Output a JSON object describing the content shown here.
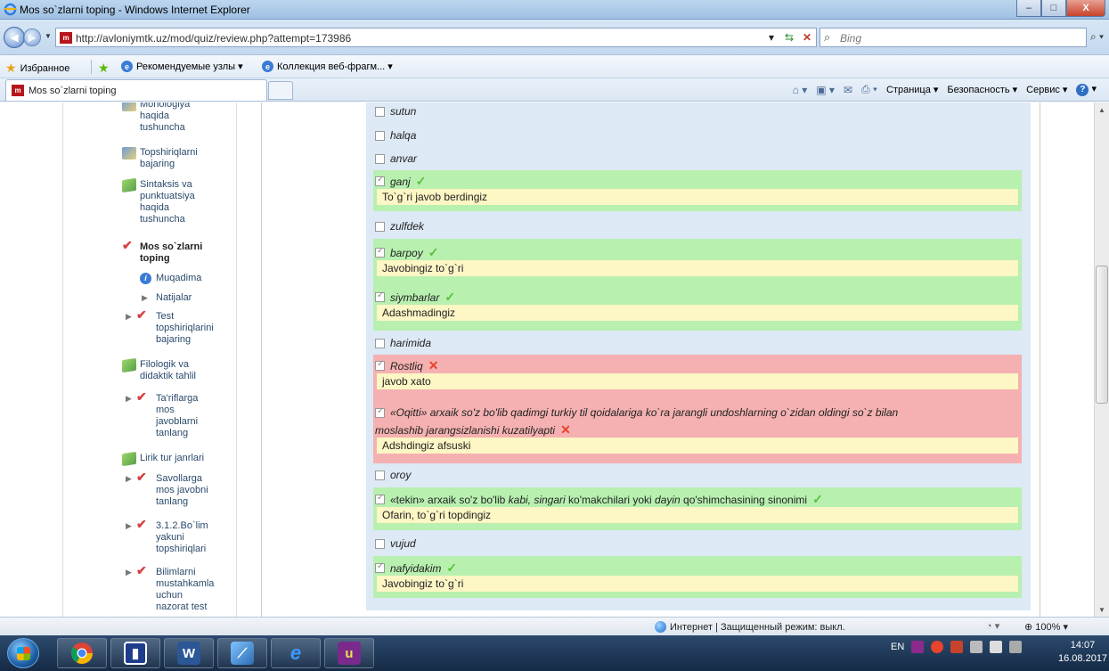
{
  "window": {
    "title": "Mos so`zlarni toping - Windows Internet Explorer",
    "minimize": "–",
    "maximize": "□",
    "close": "X"
  },
  "address": {
    "url": "http://avloniymtk.uz/mod/quiz/review.php?attempt=173986",
    "search_placeholder": "Bing"
  },
  "favorites": {
    "favorites_label": "Избранное",
    "suggested_sites": "Рекомендуемые узлы ▾",
    "web_slice_gallery": "Коллекция веб-фрагм... ▾"
  },
  "tab": {
    "title": "Mos so`zlarni toping"
  },
  "command_bar": {
    "page": "Страница ▾",
    "safety": "Безопасность ▾",
    "tools": "Сервис ▾"
  },
  "sidebar": {
    "items": [
      {
        "label": "Monologiya"
      },
      {
        "label": "haqida"
      },
      {
        "label": "tushuncha"
      },
      {
        "label": "Topshiriqlarni"
      },
      {
        "label": "bajaring"
      },
      {
        "label": "Sintaksis va"
      },
      {
        "label": "punktuatsiya"
      },
      {
        "label": "haqida"
      },
      {
        "label": "tushuncha"
      },
      {
        "label": "Mos so`zlarni"
      },
      {
        "label": "toping"
      },
      {
        "label": "Muqadima"
      },
      {
        "label": "Natijalar"
      },
      {
        "label": "Test"
      },
      {
        "label": "topshiriqlarini"
      },
      {
        "label": "bajaring"
      },
      {
        "label": "Filologik va"
      },
      {
        "label": "didaktik tahlil"
      },
      {
        "label": "Ta'riflarga"
      },
      {
        "label": "mos"
      },
      {
        "label": "javoblarni"
      },
      {
        "label": "tanlang"
      },
      {
        "label": "Lirik tur janrlari"
      },
      {
        "label": "Savollarga"
      },
      {
        "label": "mos javobni"
      },
      {
        "label": "tanlang"
      },
      {
        "label": "3.1.2.Bo`lim"
      },
      {
        "label": "yakuni"
      },
      {
        "label": "topshiriqlari"
      },
      {
        "label": "Bilimlarni"
      },
      {
        "label": "mustahkamla"
      },
      {
        "label": "uchun"
      },
      {
        "label": "nazorat test"
      }
    ]
  },
  "quiz": {
    "options": [
      {
        "text": "sutun",
        "checked": false
      },
      {
        "text": "halqa",
        "checked": false
      },
      {
        "text": "anvar",
        "checked": false
      },
      {
        "text": "ganj",
        "checked": true,
        "status": "correct",
        "feedback": "To`g`ri javob berdingiz"
      },
      {
        "text": "zulfdek",
        "checked": false
      },
      {
        "text": "barpoy",
        "checked": true,
        "status": "correct",
        "feedback": "Javobingiz to`g`ri"
      },
      {
        "text": "siymbarlar",
        "checked": true,
        "status": "correct",
        "feedback": "Adashmadingiz"
      },
      {
        "text": "harimida",
        "checked": false
      },
      {
        "text": "Rostliq",
        "checked": true,
        "status": "wrong",
        "feedback": "javob xato"
      },
      {
        "text_line1": "«Oqitti» arxaik so'z bo'lib qadimgi turkiy til qoidalariga ko`ra jarangli undoshlarning o`zidan oldingi so`z bilan",
        "text_line2": "moslashib jarangsizlanishi kuzatilyapti",
        "checked": true,
        "status": "wrong",
        "feedback": "Adshdingiz afsuski"
      },
      {
        "text": "oroy",
        "checked": false
      },
      {
        "parts": [
          "«tekin» arxaik so'z bo'lib ",
          "kabi, singari",
          " ko'makchilari yoki ",
          "dayin",
          " qo'shimchasining sinonimi"
        ],
        "checked": true,
        "status": "correct",
        "feedback": "Ofarin, to`g`ri topdingiz"
      },
      {
        "text": "vujud",
        "checked": false
      },
      {
        "text": "nafyidakim",
        "checked": true,
        "status": "correct",
        "feedback": "Javobingiz to`g`ri"
      }
    ]
  },
  "status_bar": {
    "zone": "Интернет | Защищенный режим: выкл.",
    "zoom": "100%"
  },
  "taskbar": {
    "lang": "EN",
    "time": "14:07",
    "date": "16.08.2017"
  },
  "colors": {
    "correct_bg": "#b8f0b0",
    "wrong_bg": "#f5b1b1",
    "feedback_bg": "#fdf6c5",
    "panel_bg": "#dde9f5"
  }
}
